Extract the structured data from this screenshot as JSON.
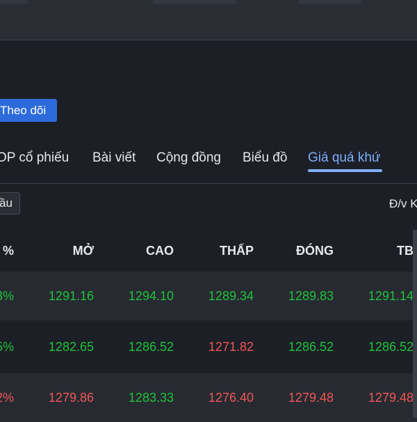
{
  "follow_button": {
    "label": "Theo dõi"
  },
  "tabs": [
    {
      "label": "OP cổ phiếu",
      "active": false
    },
    {
      "label": "Bài viết",
      "active": false
    },
    {
      "label": "Cộng đồng",
      "active": false
    },
    {
      "label": "Biểu đồ",
      "active": false
    },
    {
      "label": "Giá quá khứ",
      "active": true
    }
  ],
  "filter_chip": {
    "label": "ầu"
  },
  "unit_label": "Đ/v K",
  "table": {
    "headers": [
      "%",
      "MỞ",
      "CAO",
      "THẤP",
      "ĐÓNG",
      "TB"
    ],
    "rows": [
      {
        "cells": [
          "3%",
          "1291.16",
          "1294.10",
          "1289.34",
          "1289.83",
          "1291.14"
        ],
        "colors": [
          "up",
          "up",
          "up",
          "up",
          "up",
          "up"
        ]
      },
      {
        "cells": [
          "5%",
          "1282.65",
          "1286.52",
          "1271.82",
          "1286.52",
          "1286.52"
        ],
        "colors": [
          "up",
          "up",
          "up",
          "down",
          "up",
          "up"
        ]
      },
      {
        "cells": [
          "2%",
          "1279.86",
          "1283.33",
          "1276.40",
          "1279.48",
          "1279.48"
        ],
        "colors": [
          "down",
          "down",
          "up",
          "down",
          "down",
          "down"
        ]
      }
    ]
  },
  "colors": {
    "up": "#1fc23a",
    "down": "#ef5656",
    "accent": "#7fb0ff",
    "button": "#2d6bdb"
  }
}
